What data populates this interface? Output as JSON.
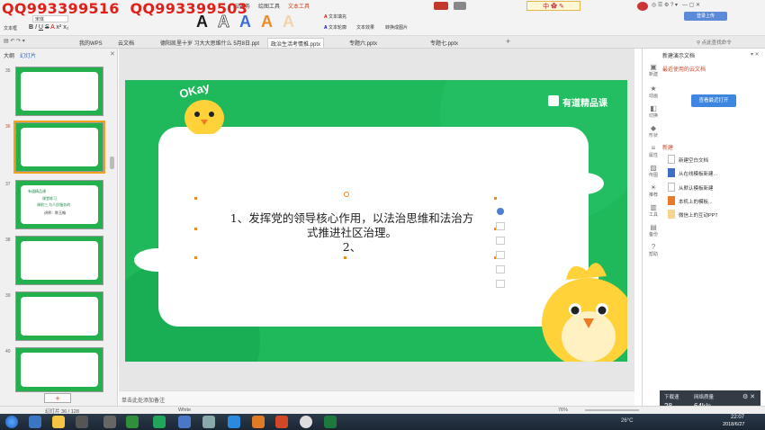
{
  "watermark": {
    "text1": "QQ993399516",
    "text2": "QQ993399503"
  },
  "ribbon": {
    "tabs": [
      "云服务",
      "绘图工具",
      "文本工具"
    ],
    "wordart_letter": "A",
    "font_color_label": "文本填充",
    "outline_label": "文本轮廓",
    "effect_label": "文本效果",
    "wrap_label": "转换成图片",
    "textbox_label": "文本框",
    "font_name": "宋体",
    "style_buttons": [
      "B",
      "I",
      "U",
      "S",
      "A",
      "x²",
      "x₂"
    ],
    "ime_label": "中",
    "sign_label": "登录上传"
  },
  "doc_tabs": [
    {
      "label": "我的WPS",
      "active": false
    },
    {
      "label": "云文档",
      "active": false
    },
    {
      "label": "德阳凯里十岁 习大大思维什么 5月8日.ppt",
      "active": false
    },
    {
      "label": "政治生活考情推.pptx",
      "active": true
    },
    {
      "label": "专题六.pptx",
      "active": false
    },
    {
      "label": "专题七.pptx",
      "active": false
    }
  ],
  "doc_tab_search": "点此查找命令",
  "left_pane": {
    "tabs": [
      "大纲",
      "幻灯片"
    ],
    "slides": [
      {
        "num": "35",
        "selected": false
      },
      {
        "num": "36",
        "selected": true
      },
      {
        "num": "37",
        "selected": false
      },
      {
        "num": "38",
        "selected": false
      },
      {
        "num": "39",
        "selected": false
      },
      {
        "num": "40",
        "selected": false
      }
    ],
    "slide37": {
      "title": "有道精品课",
      "heading": "课堂练习",
      "line": "课前三 为人民服务的",
      "teacher": "讲师：陈玉翰"
    },
    "add_button": "+"
  },
  "slide": {
    "brand": "有道精品课",
    "okay": "OKay",
    "line1": "1、发挥党的领导核心作用，以法治思维和法治方",
    "line2": "式推进社区治理。",
    "line3": "2、"
  },
  "notes_placeholder": "单击此处添加备注",
  "right_pane": {
    "title": "新建演示文档",
    "recent": "最近使用的云文档",
    "open_button": "查看最近打开",
    "new_section": "新建",
    "items": [
      "新建空白文档",
      "从在线模板新建...",
      "从默认模板新建",
      "本机上的模板...",
      "微信上的互动PPT"
    ],
    "side_icons": [
      "新建",
      "动画",
      "切换",
      "形状",
      "属性",
      "传图",
      "推荐",
      "工具",
      "备份",
      "帮助"
    ]
  },
  "network": {
    "up_label": "下载速",
    "down_label": "网络质量",
    "up_value": "28",
    "down_value": "64k/s"
  },
  "status": {
    "slide_counter": "幻灯片 36 / 128",
    "theme": "White",
    "zoom": "76%"
  },
  "taskbar": {
    "time": "22:07",
    "date": "2018/6/27",
    "temp": "26°C"
  },
  "colors": {
    "slide_green": "#1fb85a",
    "accent_orange": "#d24726",
    "watermark_red": "#e0201b"
  }
}
